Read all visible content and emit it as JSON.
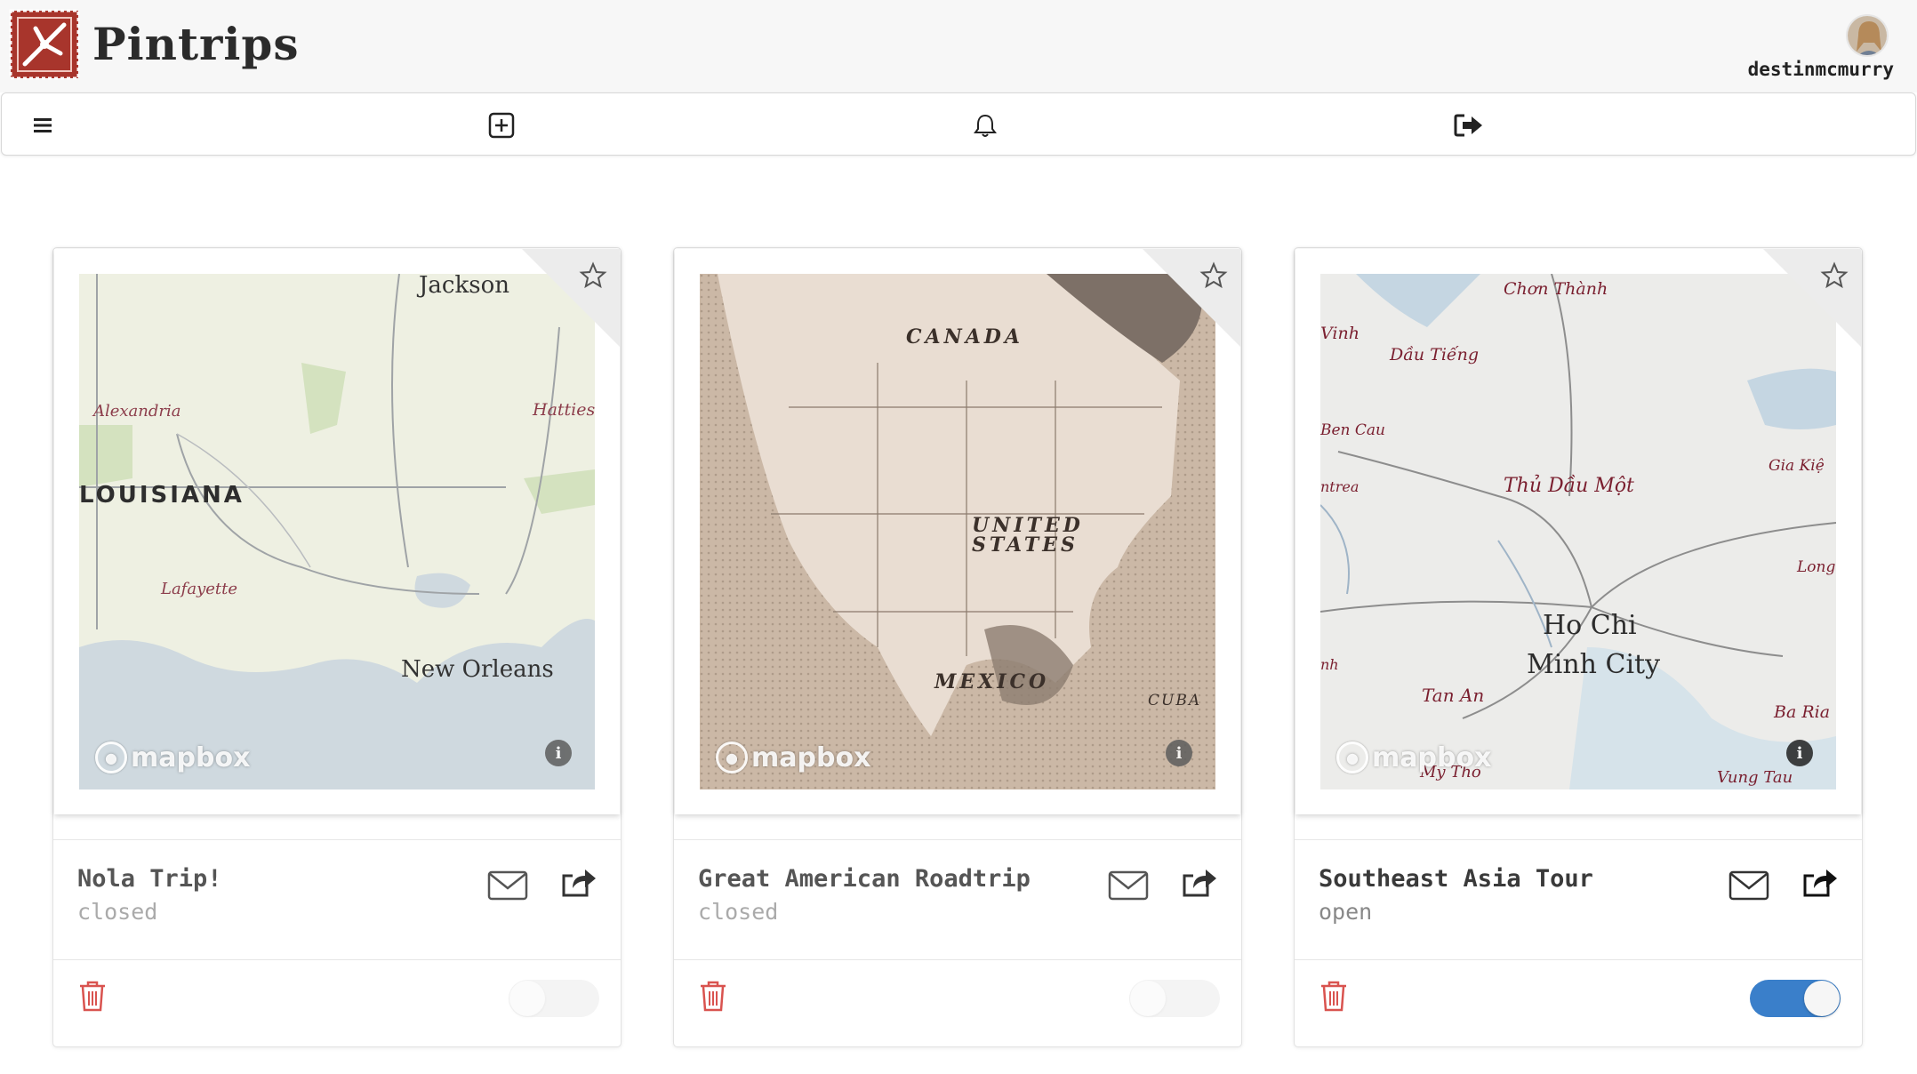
{
  "app": {
    "brand": "Pintrips",
    "username": "destinmcmurry"
  },
  "toolbar": {
    "items": [
      {
        "name": "menu-icon"
      },
      {
        "name": "add-trip-icon"
      },
      {
        "name": "bell-icon"
      },
      {
        "name": "logout-icon"
      }
    ]
  },
  "colors": {
    "accent": "#3a7fca",
    "delete": "#d9534f",
    "logo": "#a8352c"
  },
  "map_attribution": "mapbox",
  "trips": [
    {
      "title": "Nola Trip!",
      "status": "closed",
      "open": false,
      "map_labels": {
        "a": "Jackson",
        "b": "Alexandria",
        "c": "Hatties",
        "d": "LOUISIANA",
        "e": "Lafayette",
        "f": "New Orleans"
      }
    },
    {
      "title": "Great American Roadtrip",
      "status": "closed",
      "open": false,
      "map_labels": {
        "a": "CANADA",
        "b": "UNITED",
        "c": "STATES",
        "d": "MEXICO",
        "e": "CUBA"
      }
    },
    {
      "title": "Southeast Asia Tour",
      "status": "open",
      "open": true,
      "map_labels": {
        "a": "Chơn Thành",
        "b": "Vinh",
        "c": "Dầu Tiếng",
        "d": "Ben Cau",
        "e": "Gia Kiệ",
        "f": "ntrea",
        "g": "Thủ Dầu Một",
        "h": "Long",
        "i": "Ho Chi",
        "j": "Minh City",
        "k": "nh",
        "l": "Tan An",
        "m": "Ba Ria",
        "n": "My Tho",
        "o": "Vung Tau"
      }
    }
  ]
}
